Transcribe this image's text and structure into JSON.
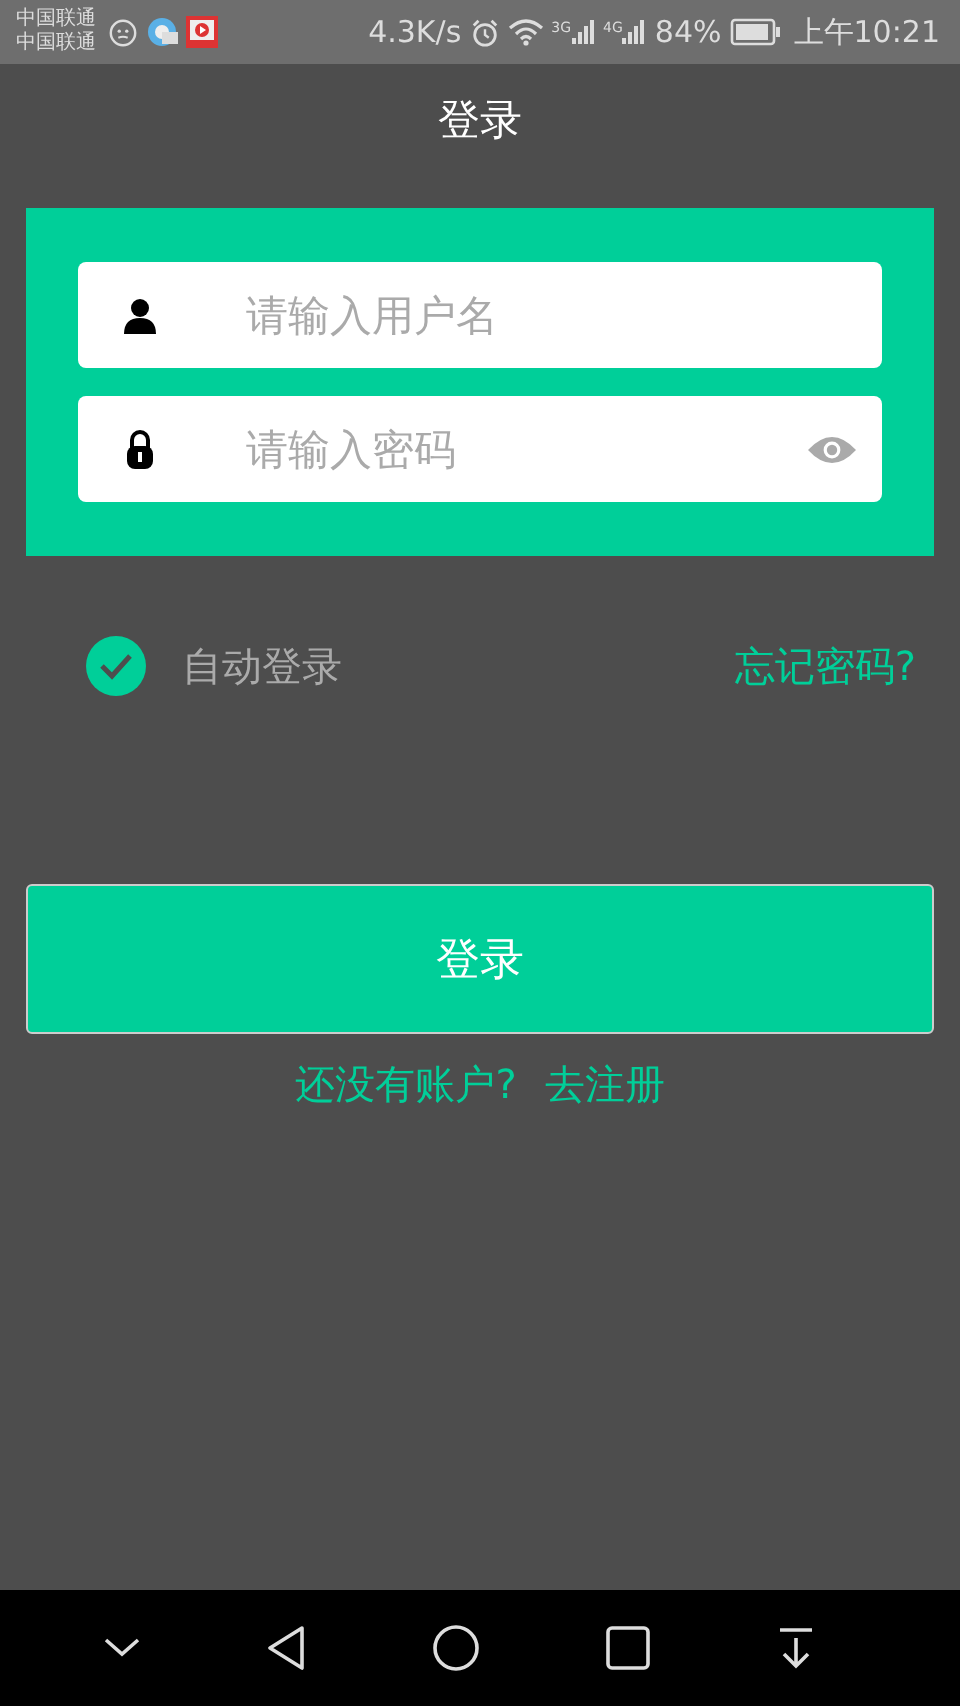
{
  "status_bar": {
    "carriers": [
      "中国联通",
      "中国联通"
    ],
    "speed": "4.3K/s",
    "network_labels": [
      "3G",
      "4G"
    ],
    "battery": "84%",
    "time": "上午10:21"
  },
  "title": "登录",
  "fields": [
    {
      "kind": "user",
      "placeholder": "请输入用户名"
    },
    {
      "kind": "password",
      "placeholder": "请输入密码"
    }
  ],
  "auto_login": {
    "label": "自动登录",
    "checked": true
  },
  "forgot_link": "忘记密码?",
  "login_button": "登录",
  "register": {
    "prompt": "还没有账户?",
    "link": "去注册"
  }
}
